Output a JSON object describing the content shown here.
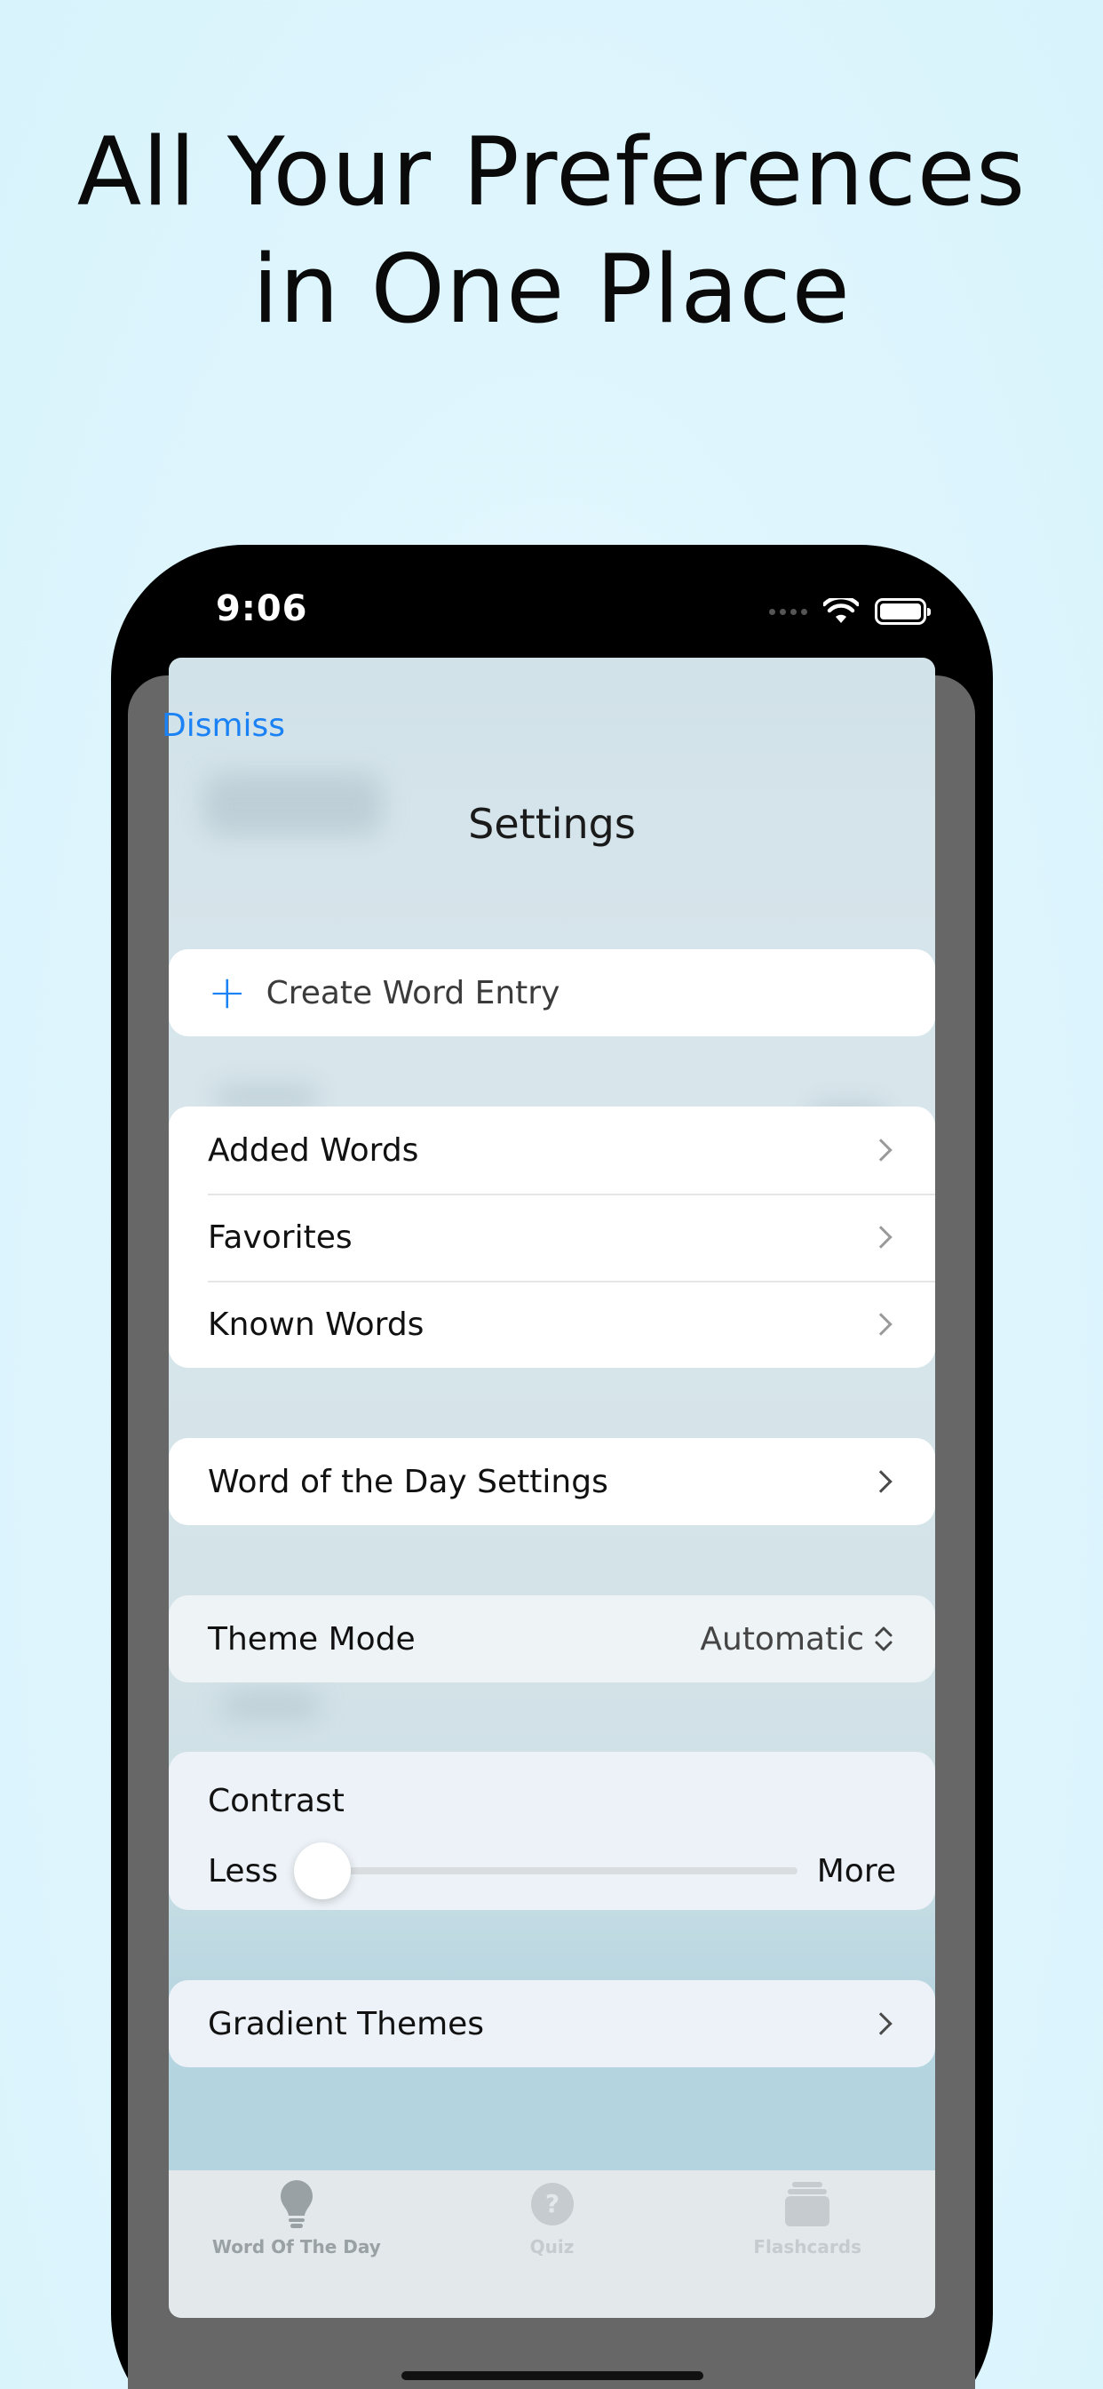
{
  "headline": {
    "line1": "All Your Preferences",
    "line2": "in One Place"
  },
  "status_bar": {
    "time": "9:06"
  },
  "sheet": {
    "dismiss_label": "Dismiss",
    "title": "Settings"
  },
  "create": {
    "icon": "plus-icon",
    "label": "Create Word Entry"
  },
  "word_lists": [
    {
      "label": "Added Words"
    },
    {
      "label": "Favorites"
    },
    {
      "label": "Known Words"
    }
  ],
  "word_of_day": {
    "label": "Word of the Day Settings"
  },
  "theme_mode": {
    "label": "Theme Mode",
    "value": "Automatic"
  },
  "contrast": {
    "title": "Contrast",
    "min_label": "Less",
    "max_label": "More",
    "level": 0
  },
  "gradient_themes": {
    "label": "Gradient Themes"
  },
  "tabbar": {
    "tabs": [
      {
        "label": "Word Of The Day",
        "icon": "lightbulb-icon",
        "active": true
      },
      {
        "label": "Quiz",
        "icon": "question-circle-icon",
        "active": false
      },
      {
        "label": "Flashcards",
        "icon": "cards-stack-icon",
        "active": false
      }
    ]
  },
  "colors": {
    "accent": "#1a82f5",
    "background": "#def5fd"
  }
}
